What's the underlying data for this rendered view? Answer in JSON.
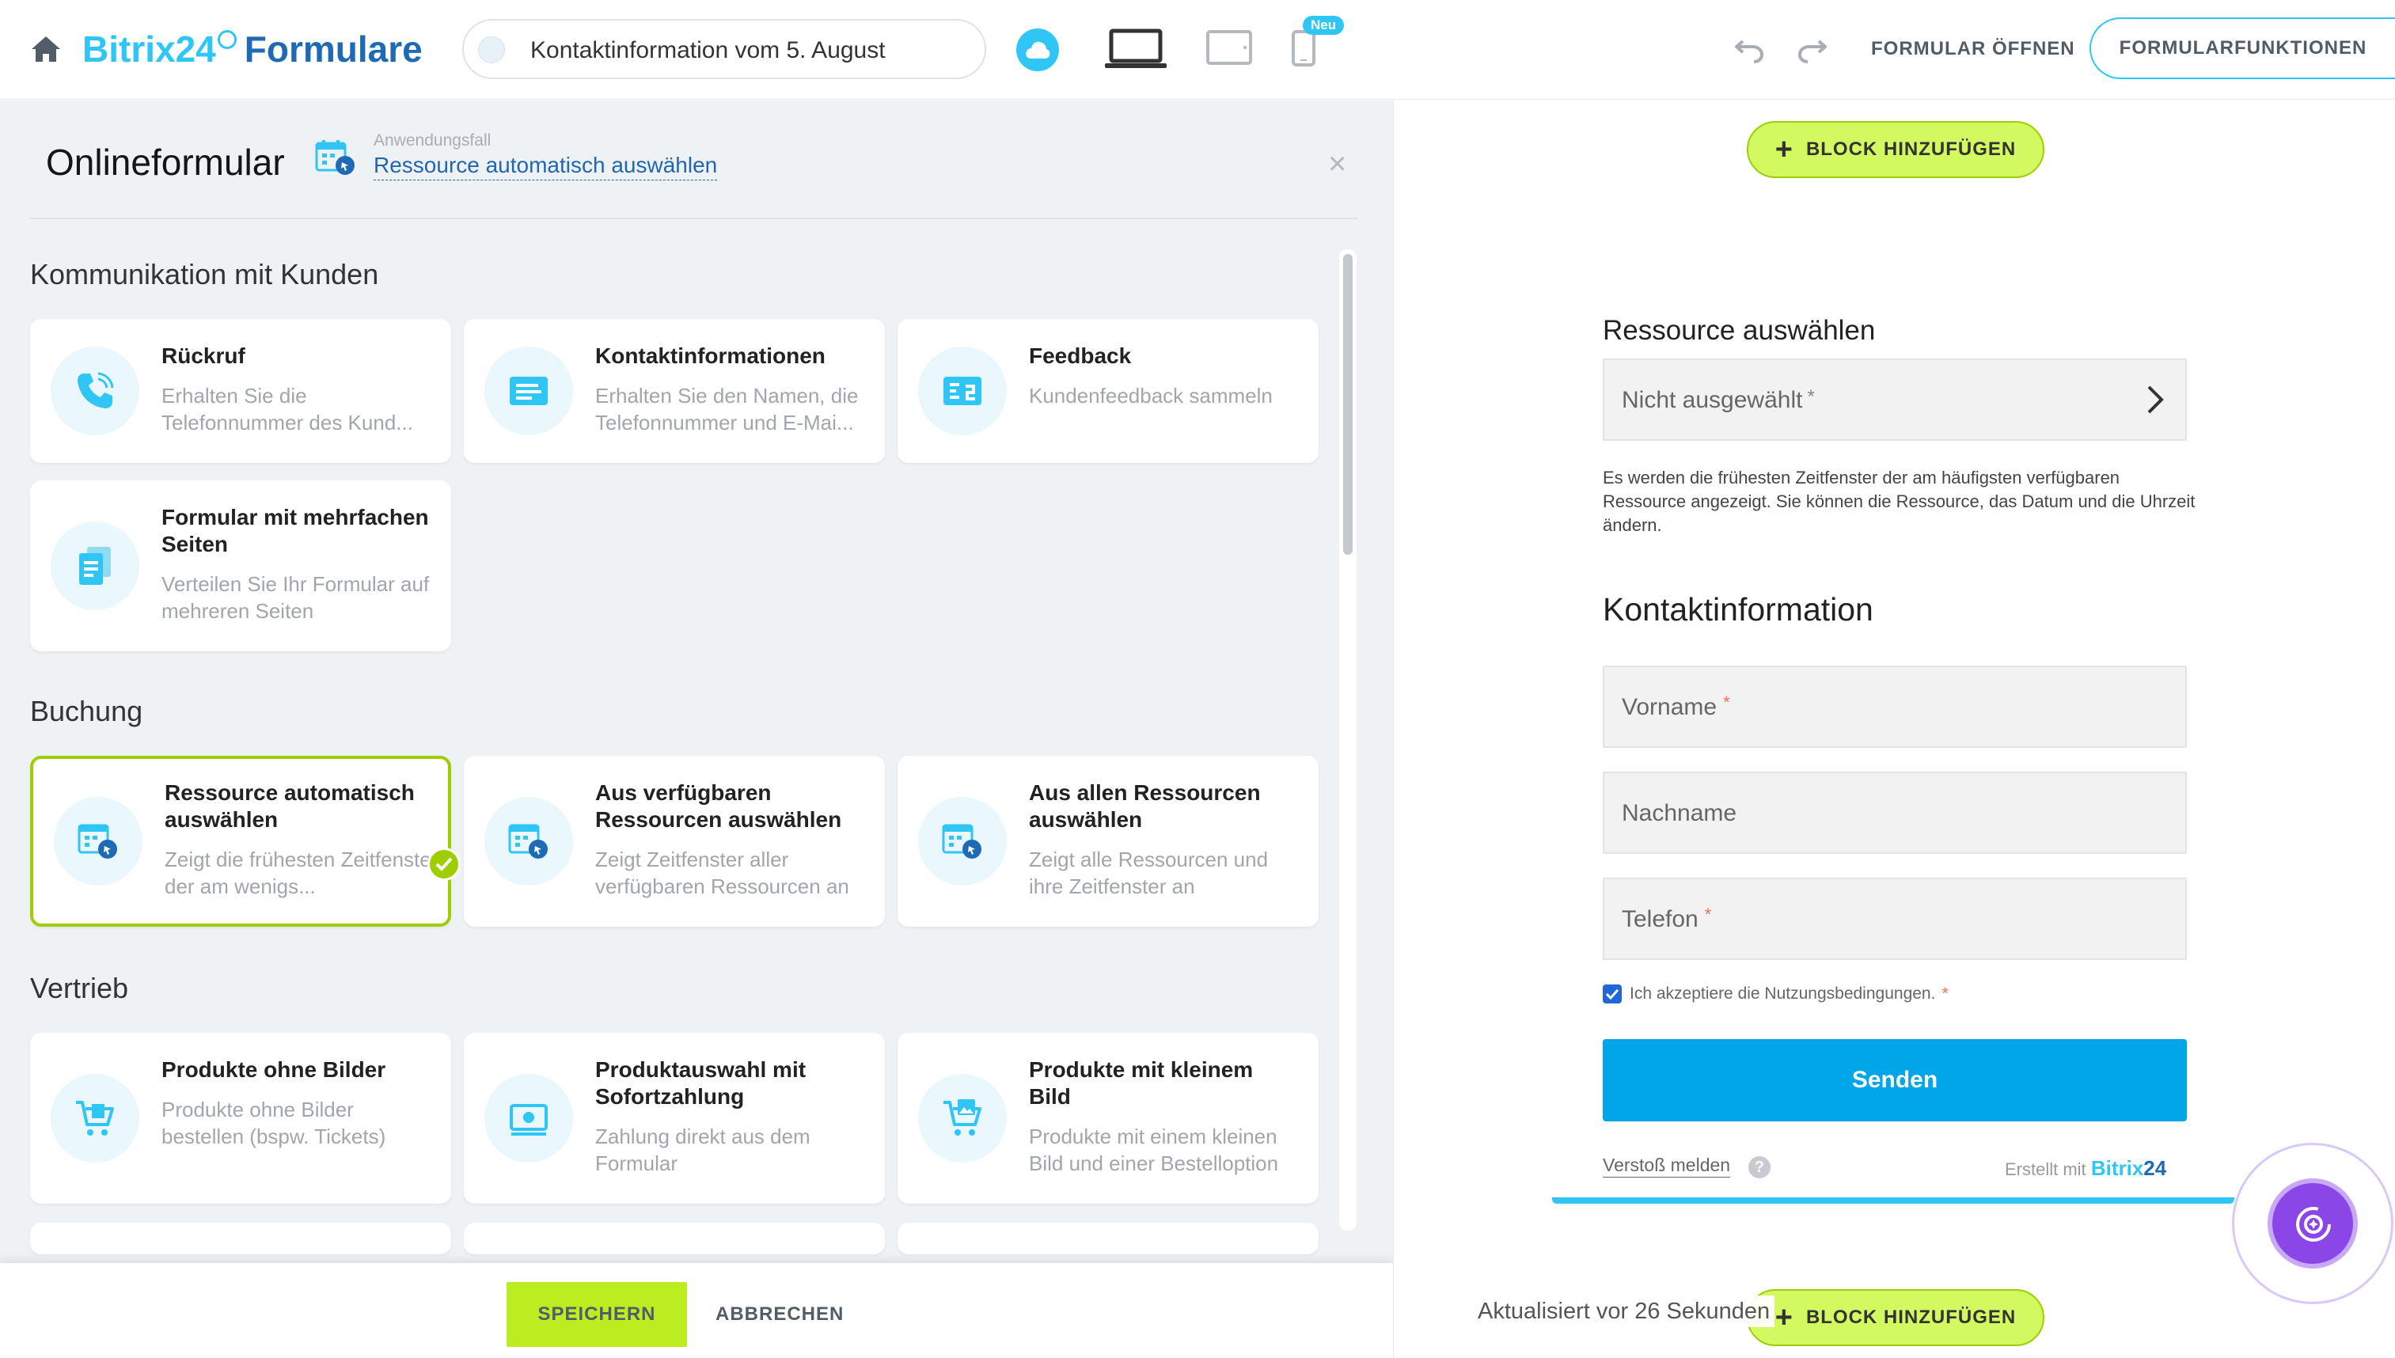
{
  "header": {
    "logo_brand": "Bitrix24",
    "logo_product": "Formulare",
    "form_title": "Kontaktinformation vom 5. August",
    "new_badge": "Neu",
    "open_form": "FORMULAR ÖFFNEN",
    "form_features": "FORMULARFUNKTIONEN"
  },
  "panel": {
    "title": "Onlineformular",
    "usecase_label": "Anwendungsfall",
    "usecase_value": "Ressource automatisch auswählen",
    "close": "×"
  },
  "sections": [
    {
      "title": "Kommunikation mit Kunden",
      "cards": [
        {
          "title": "Rückruf",
          "desc": "Erhalten Sie die Telefonnummer des Kund..."
        },
        {
          "title": "Kontaktinformationen",
          "desc": "Erhalten Sie den Namen, die Telefonnummer und E-Mai..."
        },
        {
          "title": "Feedback",
          "desc": "Kundenfeedback sammeln"
        },
        {
          "title": "Formular mit mehrfachen Seiten",
          "desc": "Verteilen Sie Ihr Formular auf mehreren Seiten"
        }
      ]
    },
    {
      "title": "Buchung",
      "cards": [
        {
          "title": "Ressource automatisch auswählen",
          "desc": "Zeigt die frühesten Zeitfenster der am wenigs...",
          "selected": true
        },
        {
          "title": "Aus verfügbaren Ressourcen auswählen",
          "desc": "Zeigt Zeitfenster aller verfügbaren Ressourcen an"
        },
        {
          "title": "Aus allen Ressourcen auswählen",
          "desc": "Zeigt alle Ressourcen und ihre Zeitfenster an"
        }
      ]
    },
    {
      "title": "Vertrieb",
      "cards": [
        {
          "title": "Produkte ohne Bilder",
          "desc": "Produkte ohne Bilder bestellen (bspw. Tickets)"
        },
        {
          "title": "Produktauswahl mit Sofortzahlung",
          "desc": "Zahlung direkt aus dem Formular"
        },
        {
          "title": "Produkte mit kleinem Bild",
          "desc": "Produkte mit einem kleinen Bild und einer Bestelloption"
        }
      ]
    }
  ],
  "footer": {
    "save": "SPEICHERN",
    "cancel": "ABBRECHEN"
  },
  "preview": {
    "add_block": "BLOCK HINZUFÜGEN",
    "resource_title": "Ressource auswählen",
    "resource_field": "Nicht ausgewählt",
    "resource_hint": "Es werden die frühesten Zeitfenster der am häufigsten verfügbaren Ressource angezeigt. Sie können die Ressource, das Datum und die Uhrzeit ändern.",
    "contact_title": "Kontaktinformation",
    "fields": [
      "Vorname",
      "Nachname",
      "Telefon"
    ],
    "terms": "Ich akzeptiere die Nutzungsbedingungen.",
    "send": "Senden",
    "report": "Verstoß melden",
    "help": "?",
    "made_with": "Erstellt mit",
    "made_brand": "Bitrix",
    "made_brand_num": "24",
    "updated": "Aktualisiert vor 26 Sekunden",
    "required_mark": "*"
  },
  "colors": {
    "accent": "#2fc6f6",
    "brand_dark": "#1f6ab5",
    "green": "#bbed21",
    "send": "#00a6e8"
  }
}
